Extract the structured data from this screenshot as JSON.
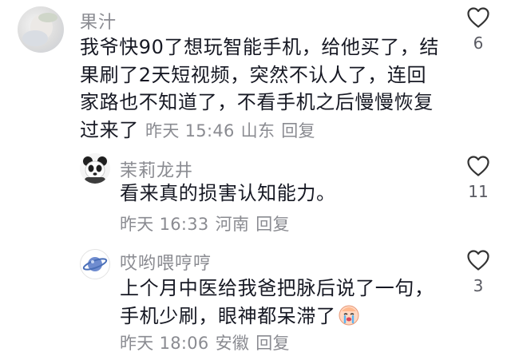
{
  "comments": [
    {
      "username": "果汁",
      "text": "我爷快90了想玩智能手机，给他买了，结果刷了2天短视频，突然不认人了，连回家路也不知道了，不看手机之后慢慢恢复过来了",
      "time": "昨天 15:46",
      "location": "山东",
      "reply_label": "回复",
      "likes": "6"
    },
    {
      "username": "茉莉龙井",
      "text": "看来真的损害认知能力。",
      "time": "昨天 16:33",
      "location": "河南",
      "reply_label": "回复",
      "likes": "11"
    },
    {
      "username": "哎哟喂哼哼",
      "text": "上个月中医给我爸把脉后说了一句，手机少刷，眼神都呆滞了",
      "time": "昨天 18:06",
      "location": "安徽",
      "reply_label": "回复",
      "likes": "3"
    }
  ],
  "icons": {
    "like": "heart-outline-icon",
    "emoji": "crying-emoji-icon"
  },
  "colors": {
    "text": "#161823",
    "secondary": "#8a8b91"
  }
}
